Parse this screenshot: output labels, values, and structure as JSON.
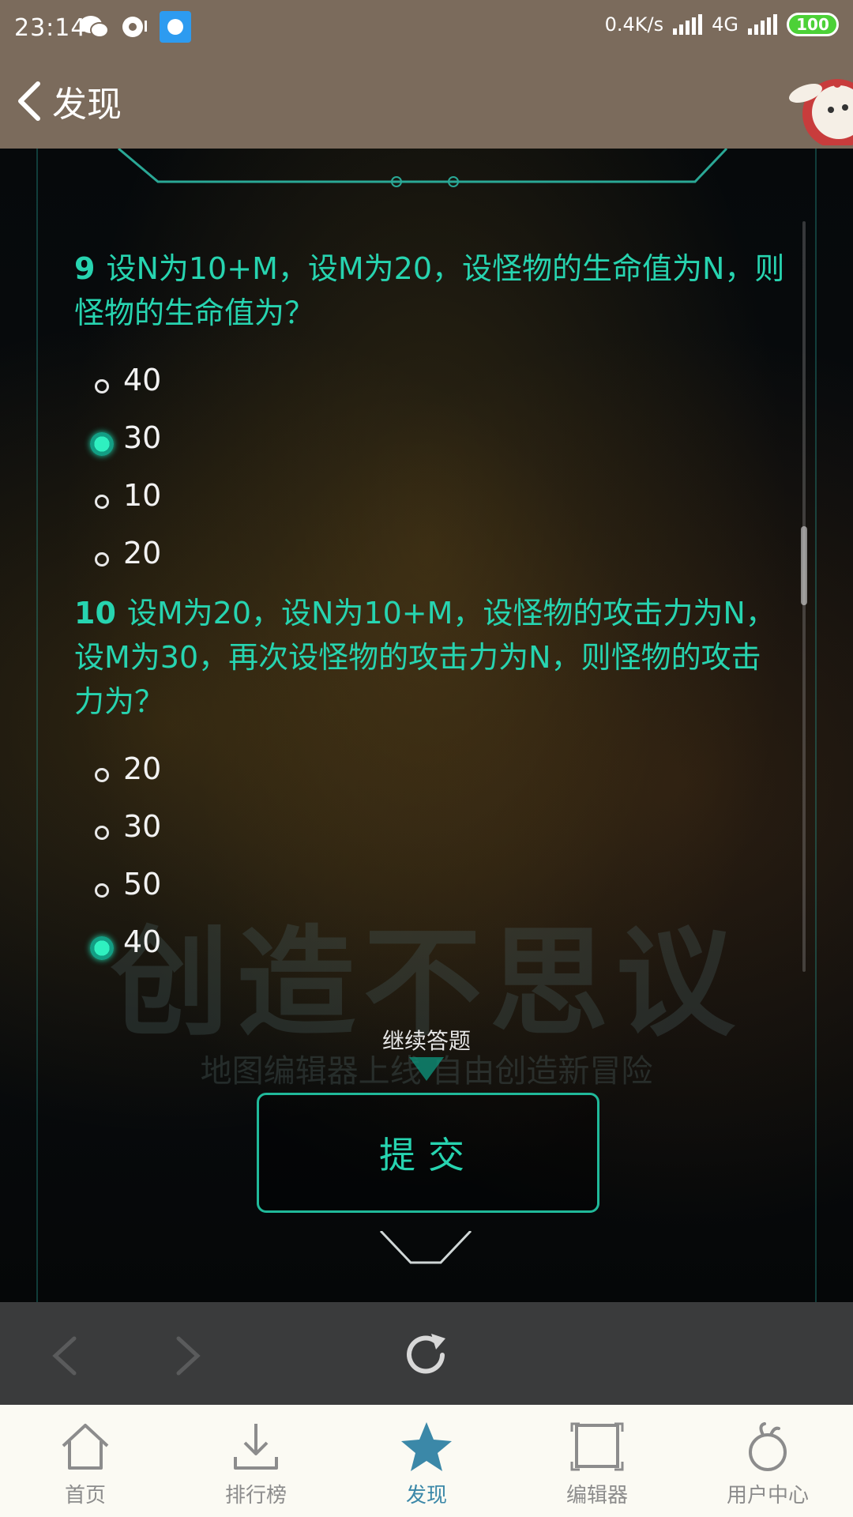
{
  "status_bar": {
    "time": "23:14",
    "net_speed": "0.4K/s",
    "network_type": "4G",
    "battery": "100",
    "app_icons": [
      "wechat-icon",
      "qq-icon",
      "browser-app-icon"
    ]
  },
  "header": {
    "title": "发现"
  },
  "questions": [
    {
      "number": "9",
      "text": "设N为10+M，设M为20，设怪物的生命值为N，则怪物的生命值为？",
      "options": [
        {
          "label": "40",
          "selected": false
        },
        {
          "label": "30",
          "selected": true
        },
        {
          "label": "10",
          "selected": false
        },
        {
          "label": "20",
          "selected": false
        }
      ]
    },
    {
      "number": "10",
      "text": "设M为20，设N为10+M，设怪物的攻击力为N，设M为30，再次设怪物的攻击力为N，则怪物的攻击力为？",
      "options": [
        {
          "label": "20",
          "selected": false
        },
        {
          "label": "30",
          "selected": false
        },
        {
          "label": "50",
          "selected": false
        },
        {
          "label": "40",
          "selected": true
        }
      ]
    }
  ],
  "background": {
    "watermark": "创造不思议",
    "tagline": "地图编辑器上线 自由创造新冒险"
  },
  "continue_label": "继续答题",
  "submit_label": "提交",
  "bottom_tabs": [
    {
      "label": "首页",
      "icon": "home-icon",
      "active": false
    },
    {
      "label": "排行榜",
      "icon": "download-icon",
      "active": false
    },
    {
      "label": "发现",
      "icon": "star-icon",
      "active": true
    },
    {
      "label": "编辑器",
      "icon": "editor-frame-icon",
      "active": false
    },
    {
      "label": "用户中心",
      "icon": "user-center-icon",
      "active": false
    }
  ],
  "colors": {
    "accent": "#27d4b0",
    "header_bg": "#7b6b5c",
    "active_tab": "#3b88a8"
  }
}
